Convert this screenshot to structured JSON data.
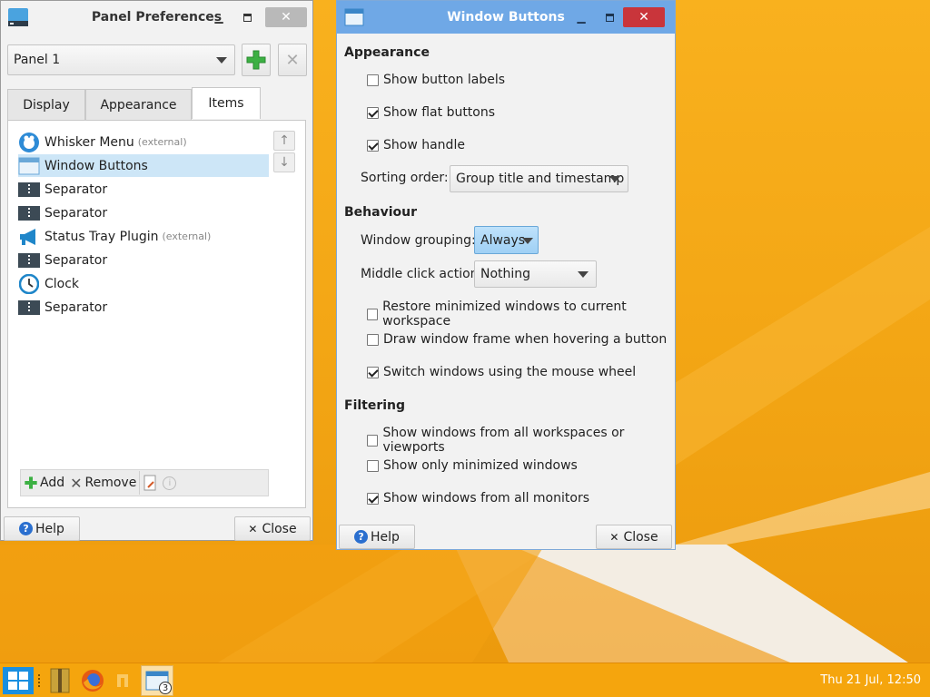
{
  "colors": {
    "accent": "#6fa8e6",
    "close_red": "#c9353b",
    "selection": "#cde6f7",
    "taskbar": "#f5a50d"
  },
  "panel_prefs": {
    "title": "Panel Preferences",
    "panel_select": "Panel 1",
    "tabs": [
      {
        "label": "Display",
        "active": false
      },
      {
        "label": "Appearance",
        "active": false
      },
      {
        "label": "Items",
        "active": true
      }
    ],
    "items": [
      {
        "label": "Whisker Menu",
        "tag": "(external)",
        "icon": "whisker-menu-icon",
        "selected": false
      },
      {
        "label": "Window Buttons",
        "tag": "",
        "icon": "window-icon",
        "selected": true
      },
      {
        "label": "Separator",
        "tag": "",
        "icon": "separator-icon",
        "selected": false
      },
      {
        "label": "Separator",
        "tag": "",
        "icon": "separator-icon",
        "selected": false
      },
      {
        "label": "Status Tray Plugin",
        "tag": "(external)",
        "icon": "megaphone-icon",
        "selected": false
      },
      {
        "label": "Separator",
        "tag": "",
        "icon": "separator-icon",
        "selected": false
      },
      {
        "label": "Clock",
        "tag": "",
        "icon": "clock-icon",
        "selected": false
      },
      {
        "label": "Separator",
        "tag": "",
        "icon": "separator-icon",
        "selected": false
      }
    ],
    "add_label": "Add",
    "remove_label": "Remove",
    "help_label": "Help",
    "close_label": "Close"
  },
  "window_buttons": {
    "title": "Window Buttons",
    "appearance": {
      "heading": "Appearance",
      "show_button_labels": {
        "label": "Show button labels",
        "checked": false
      },
      "show_flat_buttons": {
        "label": "Show flat buttons",
        "checked": true
      },
      "show_handle": {
        "label": "Show handle",
        "checked": true
      },
      "sorting_label": "Sorting order:",
      "sorting_value": "Group title and timestamp"
    },
    "behaviour": {
      "heading": "Behaviour",
      "grouping_label": "Window grouping:",
      "grouping_value": "Always",
      "middle_label": "Middle click action:",
      "middle_value": "Nothing",
      "restore_minimized": {
        "label": "Restore minimized windows to current workspace",
        "checked": false
      },
      "draw_frame": {
        "label": "Draw window frame when hovering a button",
        "checked": false
      },
      "switch_wheel": {
        "label": "Switch windows using the mouse wheel",
        "checked": true
      }
    },
    "filtering": {
      "heading": "Filtering",
      "all_workspaces": {
        "label": "Show windows from all workspaces or viewports",
        "checked": false
      },
      "only_minimized": {
        "label": "Show only minimized windows",
        "checked": false
      },
      "all_monitors": {
        "label": "Show windows from all monitors",
        "checked": true
      }
    },
    "help_label": "Help",
    "close_label": "Close"
  },
  "taskbar": {
    "window_count": "3",
    "clock": "Thu 21 Jul, 12:50"
  }
}
